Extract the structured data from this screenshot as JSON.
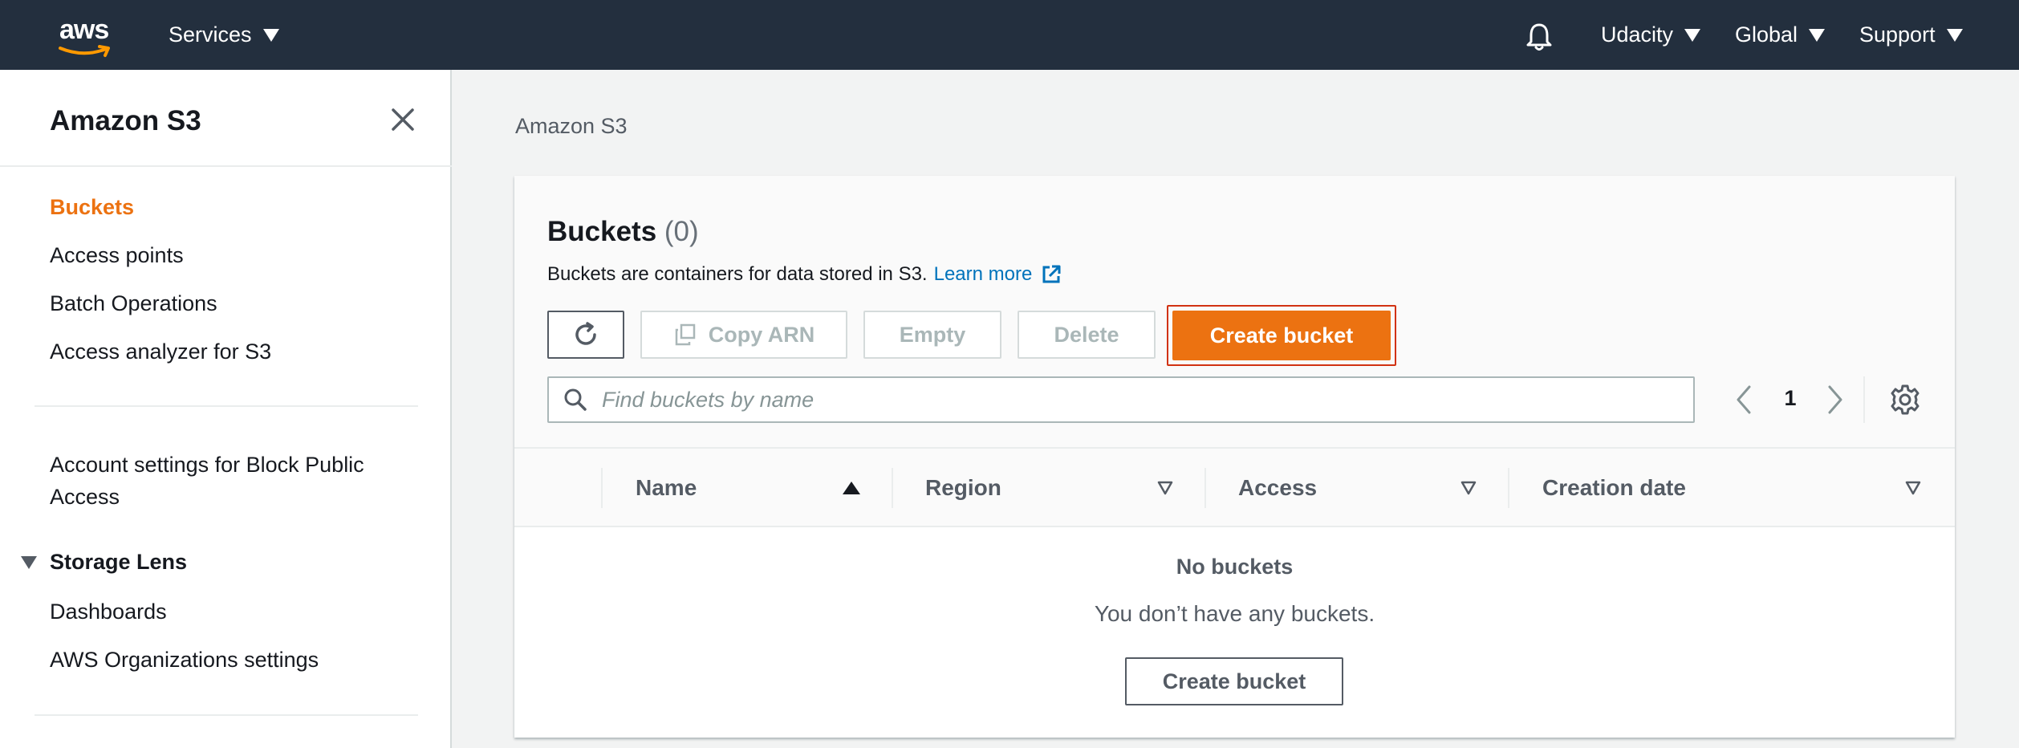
{
  "topnav": {
    "logo_text": "aws",
    "services": "Services",
    "account": "Udacity",
    "region": "Global",
    "support": "Support"
  },
  "sidebar": {
    "title": "Amazon S3",
    "items": [
      {
        "label": "Buckets",
        "active": true
      },
      {
        "label": "Access points"
      },
      {
        "label": "Batch Operations"
      },
      {
        "label": "Access analyzer for S3"
      }
    ],
    "account_settings": "Account settings for Block Public",
    "account_settings_2": "Access",
    "storage_lens": {
      "label": "Storage Lens",
      "items": [
        {
          "label": "Dashboards"
        },
        {
          "label": "AWS Organizations settings"
        }
      ]
    }
  },
  "breadcrumb": "Amazon S3",
  "buckets": {
    "title": "Buckets",
    "count": "(0)",
    "description": "Buckets are containers for data stored in S3.",
    "learn_more": "Learn more",
    "actions": {
      "copy_arn": "Copy ARN",
      "empty": "Empty",
      "delete": "Delete",
      "create": "Create bucket"
    },
    "search_placeholder": "Find buckets by name",
    "page": "1",
    "columns": [
      "Name",
      "Region",
      "Access",
      "Creation date"
    ],
    "empty_title": "No buckets",
    "empty_desc": "You don’t have any buckets.",
    "empty_create": "Create bucket"
  },
  "colors": {
    "nav_bg": "#232f3e",
    "accent": "#ec7211",
    "link": "#0073bb",
    "highlight": "#d13212"
  }
}
